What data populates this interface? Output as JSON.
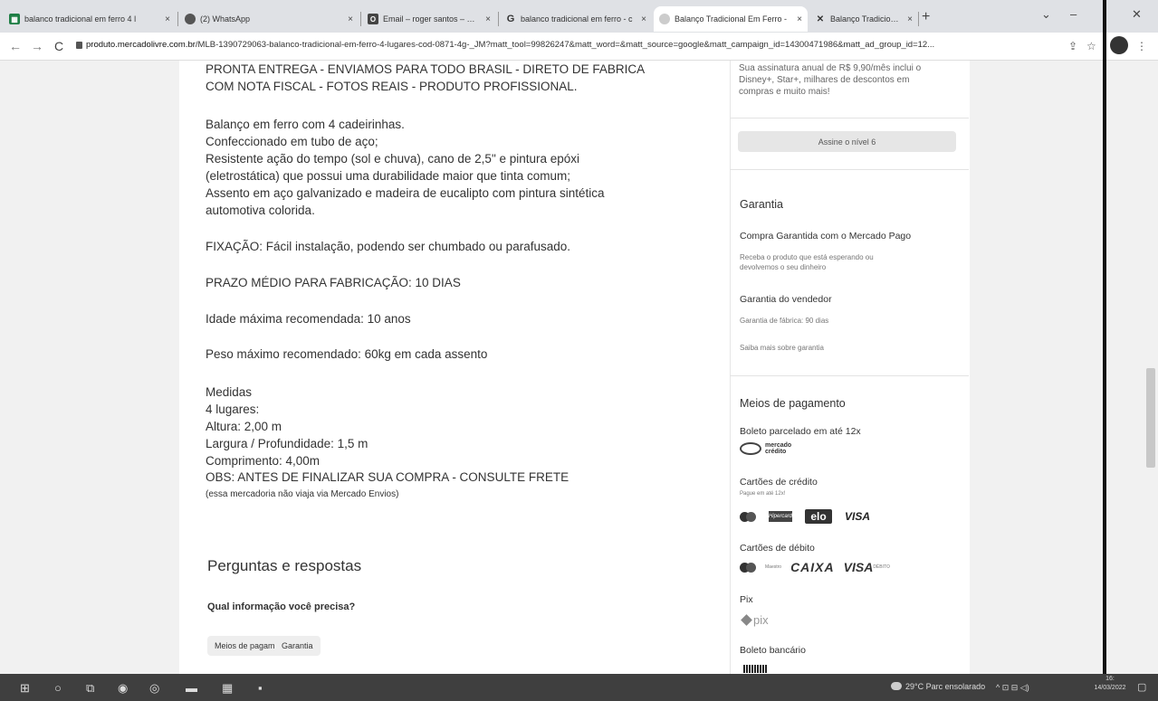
{
  "browser": {
    "tabs": [
      {
        "title": "balanco tradicional em ferro 4 l",
        "icon": "spreadsheet-icon",
        "close": "×"
      },
      {
        "title": "(2) WhatsApp",
        "icon": "whatsapp-icon",
        "close": "×"
      },
      {
        "title": "Email – roger santos – Outlook",
        "icon": "outlook-icon",
        "close": "×"
      },
      {
        "title": "balanco tradicional em ferro - c",
        "icon": "google-icon",
        "close": "×"
      },
      {
        "title": "Balanço Tradicional Em Ferro -",
        "icon": "mercadolivre-icon",
        "close": "×"
      },
      {
        "title": "Balanço Tradicional Em Ferro -",
        "icon": "tab-icon",
        "close": "×"
      }
    ],
    "new_tab": "+",
    "url_domain": "produto.mercadolivre.com.br",
    "url_path": "/MLB-1390729063-balanco-tradicional-em-ferro-4-lugares-cod-0871-4g-_JM?matt_tool=99826247&matt_word=&matt_source=google&matt_campaign_id=14300471986&matt_ad_group_id=12..."
  },
  "description": {
    "line1": "PRONTA ENTREGA - ENVIAMOS PARA TODO BRASIL - DIRETO DE FABRICA",
    "line2": "COM NOTA FISCAL - FOTOS REAIS - PRODUTO PROFISSIONAL.",
    "line3": "Balanço em ferro com 4 cadeirinhas.",
    "line4": "Confeccionado em tubo de aço;",
    "line5": "Resistente ação do tempo (sol e chuva), cano de 2,5\" e pintura epóxi",
    "line6": "(eletrostática) que possui uma durabilidade maior que tinta comum;",
    "line7": "Assento em aço galvanizado e madeira de eucalipto com pintura sintética",
    "line8": "automotiva colorida.",
    "fixacao": "FIXAÇÃO: Fácil instalação, podendo ser chumbado ou parafusado.",
    "prazo": "PRAZO MÉDIO PARA FABRICAÇÃO: 10 DIAS",
    "idade": "Idade máxima recomendada: 10 anos",
    "peso": "Peso máximo recomendado: 60kg em cada assento",
    "medidas": "Medidas",
    "lugares": "4 lugares:",
    "altura": "Altura: 2,00 m",
    "largura": "Largura / Profundidade: 1,5 m",
    "comprimento": "Comprimento: 4,00m",
    "obs": "OBS: ANTES DE FINALIZAR SUA COMPRA - CONSULTE FRETE",
    "note": "(essa mercadoria não viaja via Mercado Envios)"
  },
  "qa": {
    "title": "Perguntas e respostas",
    "subtitle": "Qual informação você precisa?",
    "chips": [
      "Meios de pagamento",
      "Garantia"
    ]
  },
  "sidebar": {
    "subscription_text": [
      "Sua assinatura anual de R$ 9,90/mês inclui o",
      "Disney+, Star+, milhares de descontos em",
      "compras e muito mais!"
    ],
    "subscribe_button": "Assine o nível 6",
    "warranty": {
      "title": "Garantia",
      "mp_title": "Compra Garantida com o Mercado Pago",
      "mp_text": [
        "Receba o produto que está esperando ou",
        "devolvemos o seu dinheiro"
      ],
      "seller_title": "Garantia do vendedor",
      "seller_text": "Garantia de fábrica: 90 dias",
      "more_link": "Saiba mais sobre garantia"
    },
    "payment": {
      "title": "Meios de pagamento",
      "boleto_parcelado": "Boleto parcelado em até 12x",
      "mercado_credito": [
        "mercado",
        "crédito"
      ],
      "credit_title": "Cartões de crédito",
      "credit_sub": "Pague em até 12x!",
      "hipercard": "Hipercard",
      "elo": "elo",
      "visa": "VISA",
      "debit_title": "Cartões de débito",
      "maestro_sub": "Maestro",
      "caixa": "CAIXA",
      "visa_debit": "VISA",
      "visa_debit_sub": "DÉBITO",
      "pix_title": "Pix",
      "pix_logo": "pix",
      "boleto_title": "Boleto bancário"
    }
  },
  "taskbar": {
    "weather": "29°C Parc ensolarado",
    "time": "16:",
    "date": "14/03/2022"
  }
}
